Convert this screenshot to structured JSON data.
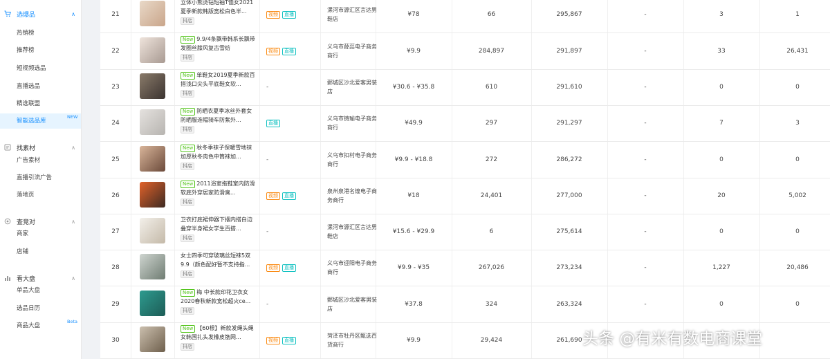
{
  "sidebar": {
    "sections": [
      {
        "label": "选爆品",
        "icon": "cart-icon",
        "active": true,
        "items": [
          {
            "label": "热销榜"
          },
          {
            "label": "推荐榜"
          },
          {
            "label": "短视频选品"
          },
          {
            "label": "直播选品"
          },
          {
            "label": "精选联盟"
          },
          {
            "label": "智能选品库",
            "badge": "NEW",
            "selected": true
          }
        ]
      },
      {
        "label": "找素材",
        "icon": "material-icon",
        "items": [
          {
            "label": "广告素材"
          },
          {
            "label": "直播引流广告"
          },
          {
            "label": "落地页"
          }
        ]
      },
      {
        "label": "查竞对",
        "icon": "target-icon",
        "items": [
          {
            "label": "商家"
          },
          {
            "label": "店铺"
          }
        ]
      },
      {
        "label": "看大盘",
        "icon": "bar-chart-icon",
        "items": [
          {
            "label": "单品大盘"
          },
          {
            "label": "选品日历"
          },
          {
            "label": "商品大盘",
            "badge": "Beta"
          }
        ]
      }
    ]
  },
  "labels": {
    "new": "New",
    "platform": "抖店",
    "video": "视频",
    "live": "直播",
    "dash": "-"
  },
  "colors": {
    "accent": "#1890ff",
    "new_tag": "#52c41a",
    "video_tag": "#fa8c16",
    "live_tag": "#13c2c2"
  },
  "rows": [
    {
      "rank": "21",
      "new": false,
      "title": "立体小熊烫钻短袖T恤女2021夏季新款韩版宽松白色半...",
      "thumb": [
        "#e9d9c8",
        "#c9a58a"
      ],
      "video": true,
      "live": true,
      "shop": "漯河市源汇区言达男鞋店",
      "price": "¥78",
      "c1": "66",
      "c2": "295,867",
      "c3": "-",
      "c4": "3",
      "c5": "1"
    },
    {
      "rank": "22",
      "new": true,
      "title": "9.9/4条飘带韩系长飘带发圈丝膝风复古雪纺",
      "thumb": [
        "#efe4dc",
        "#a89a92"
      ],
      "video": true,
      "live": true,
      "shop": "义乌市薛蕊电子商务商行",
      "price": "¥9.9",
      "c1": "284,897",
      "c2": "291,897",
      "c3": "-",
      "c4": "33",
      "c5": "26,431"
    },
    {
      "rank": "23",
      "new": true,
      "title": "单鞋女2019夏季新款百搭浅口尖头平底鞋女软...",
      "thumb": [
        "#8a7b6a",
        "#3b3330"
      ],
      "video": false,
      "live": false,
      "shop": "鄄城区沙北爱客男装店",
      "price": "¥30.6 - ¥35.8",
      "c1": "610",
      "c2": "291,610",
      "c3": "-",
      "c4": "0",
      "c5": "0"
    },
    {
      "rank": "24",
      "new": true,
      "title": "防晒衣夏季冰丝外套女防晒服连帽骑车防紫外...",
      "thumb": [
        "#e5e2df",
        "#b7b4b0"
      ],
      "video": false,
      "live": true,
      "shop": "义乌市铸瑜电子商务商行",
      "price": "¥49.9",
      "c1": "297",
      "c2": "291,297",
      "c3": "-",
      "c4": "7",
      "c5": "3"
    },
    {
      "rank": "25",
      "new": true,
      "title": "秋冬季袜子保暖雪地袜加厚秋冬肉色中筒袜加...",
      "thumb": [
        "#d9b59a",
        "#6b4a3a"
      ],
      "video": false,
      "live": false,
      "shop": "义乌市扣村电子商务商行",
      "price": "¥9.9 - ¥18.8",
      "c1": "272",
      "c2": "286,272",
      "c3": "-",
      "c4": "0",
      "c5": "0"
    },
    {
      "rank": "26",
      "new": true,
      "title": "2011浴室拖鞋室内防滑软底外穿居家防滑臭...",
      "thumb": [
        "#e2622a",
        "#3d2a22"
      ],
      "video": true,
      "live": true,
      "shop": "泉州泉港名煌电子商务商行",
      "price": "¥18",
      "c1": "24,401",
      "c2": "277,000",
      "c3": "-",
      "c4": "20",
      "c5": "5,002"
    },
    {
      "rank": "27",
      "new": false,
      "title": "卫衣打底裙伸器下摆内搭白边叠穿半身裙女学生百搭...",
      "thumb": [
        "#f3f0ea",
        "#c4b9a8"
      ],
      "video": false,
      "live": false,
      "shop": "漯河市源汇区言达男鞋店",
      "price": "¥15.6 - ¥29.9",
      "c1": "6",
      "c2": "275,614",
      "c3": "-",
      "c4": "0",
      "c5": "0"
    },
    {
      "rank": "28",
      "new": false,
      "title": "女士四季可穿玻璃丝短袜5双9.9（颜色配好暂不支持指...",
      "thumb": [
        "#cfd5d0",
        "#6f7c72"
      ],
      "video": true,
      "live": true,
      "shop": "义乌市迎阳电子商务商行",
      "price": "¥9.9 - ¥35",
      "c1": "267,026",
      "c2": "273,234",
      "c3": "-",
      "c4": "1,227",
      "c5": "20,486"
    },
    {
      "rank": "29",
      "new": true,
      "title": "梅 中长款印花卫衣女2020春秋新款宽松超火ce...",
      "thumb": [
        "#2e9b8f",
        "#1d5c56"
      ],
      "video": false,
      "live": false,
      "shop": "鄄城区沙北爱客男装店",
      "price": "¥37.8",
      "c1": "324",
      "c2": "263,324",
      "c3": "-",
      "c4": "0",
      "c5": "0"
    },
    {
      "rank": "30",
      "new": true,
      "title": "【60根】新款发绳头绳女韩国扎头发橡皮筋网...",
      "thumb": [
        "#cbbfae",
        "#6e5f4c"
      ],
      "video": true,
      "live": true,
      "shop": "菏泽市牡丹区甄选百货商行",
      "price": "¥9.9",
      "c1": "29,424",
      "c2": "261,690",
      "c3": "",
      "c4": "",
      "c5": ""
    }
  ],
  "watermark": "头条 @有米有数电商课堂"
}
